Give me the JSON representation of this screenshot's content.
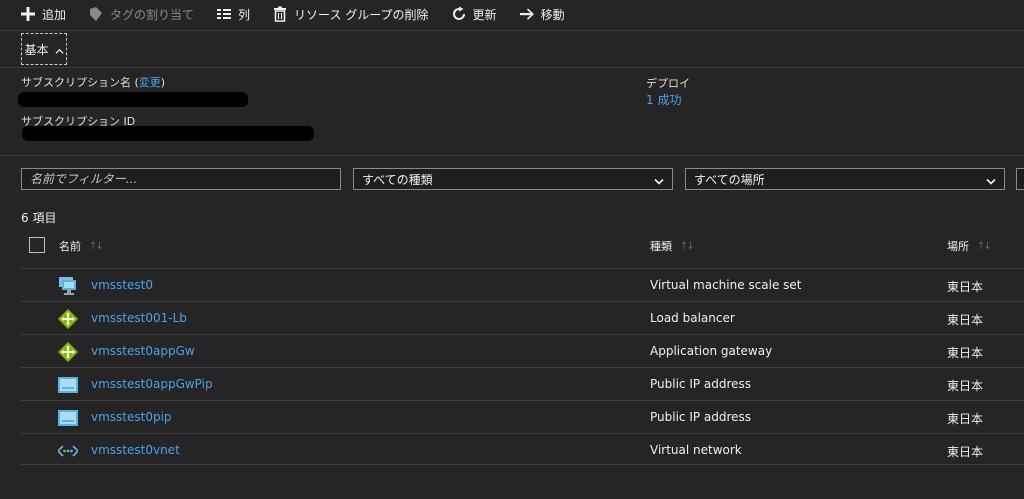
{
  "toolbar": {
    "add": "追加",
    "assign_tags": "タグの割り当て",
    "columns": "列",
    "delete_group": "リソース グループの削除",
    "refresh": "更新",
    "move": "移動"
  },
  "essentials": {
    "tab_label": "基本",
    "subscription_name_label": "サブスクリプション名 (",
    "change_link": "変更",
    "subscription_name_suffix": ")",
    "subscription_id_label": "サブスクリプション ID",
    "deploy_label": "デプロイ",
    "deploy_value": "1 成功"
  },
  "filters": {
    "name_placeholder": "名前でフィルター...",
    "type_value": "すべての種類",
    "location_value": "すべての場所"
  },
  "table": {
    "count": "6 項目",
    "columns": {
      "name": "名前",
      "type": "種類",
      "location": "場所"
    },
    "rows": [
      {
        "name": "vmsstest0",
        "type": "Virtual machine scale set",
        "location": "東日本",
        "icon": "vmss-icon"
      },
      {
        "name": "vmsstest001-Lb",
        "type": "Load balancer",
        "location": "東日本",
        "icon": "load-balancer-icon"
      },
      {
        "name": "vmsstest0appGw",
        "type": "Application gateway",
        "location": "東日本",
        "icon": "app-gateway-icon"
      },
      {
        "name": "vmsstest0appGwPip",
        "type": "Public IP address",
        "location": "東日本",
        "icon": "public-ip-icon"
      },
      {
        "name": "vmsstest0pip",
        "type": "Public IP address",
        "location": "東日本",
        "icon": "public-ip-icon"
      },
      {
        "name": "vmsstest0vnet",
        "type": "Virtual network",
        "location": "東日本",
        "icon": "vnet-icon"
      }
    ]
  },
  "colors": {
    "background": "#252526",
    "link": "#4aa3e8",
    "divider": "#3e3e40"
  }
}
